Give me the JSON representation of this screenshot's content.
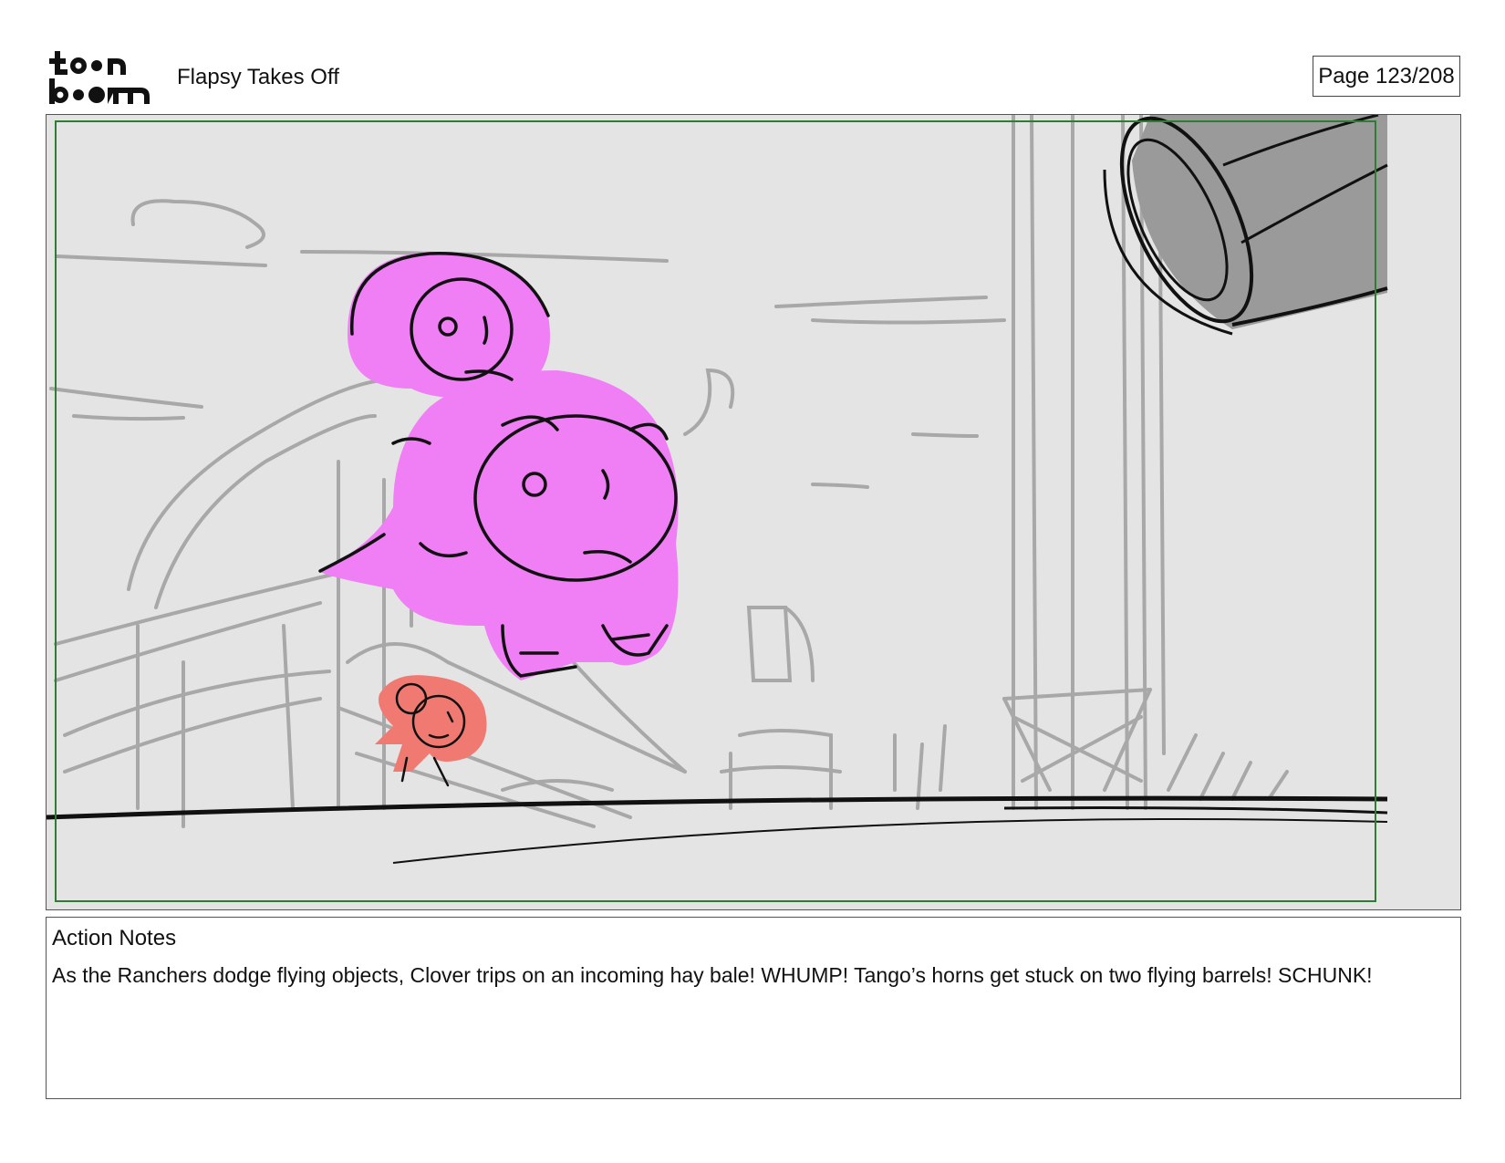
{
  "header": {
    "logo_text": "toon boom",
    "project_title": "Flapsy Takes Off",
    "page_label": "Page 123/208"
  },
  "panel": {
    "image_description_icon": "storyboard-sketch",
    "colors": {
      "background": "#e4e4e4",
      "safe_frame": "#2e7d32",
      "sketch_gray": "#a8a8a8",
      "character_magenta": "#f07ef5",
      "character_red": "#f07a72",
      "barrel": "#9a9a9a",
      "ink": "#111111"
    }
  },
  "notes": {
    "heading": "Action Notes",
    "text": "As the Ranchers dodge flying objects, Clover trips on an incoming hay bale! WHUMP! Tango’s horns get stuck on two flying barrels! SCHUNK!"
  }
}
